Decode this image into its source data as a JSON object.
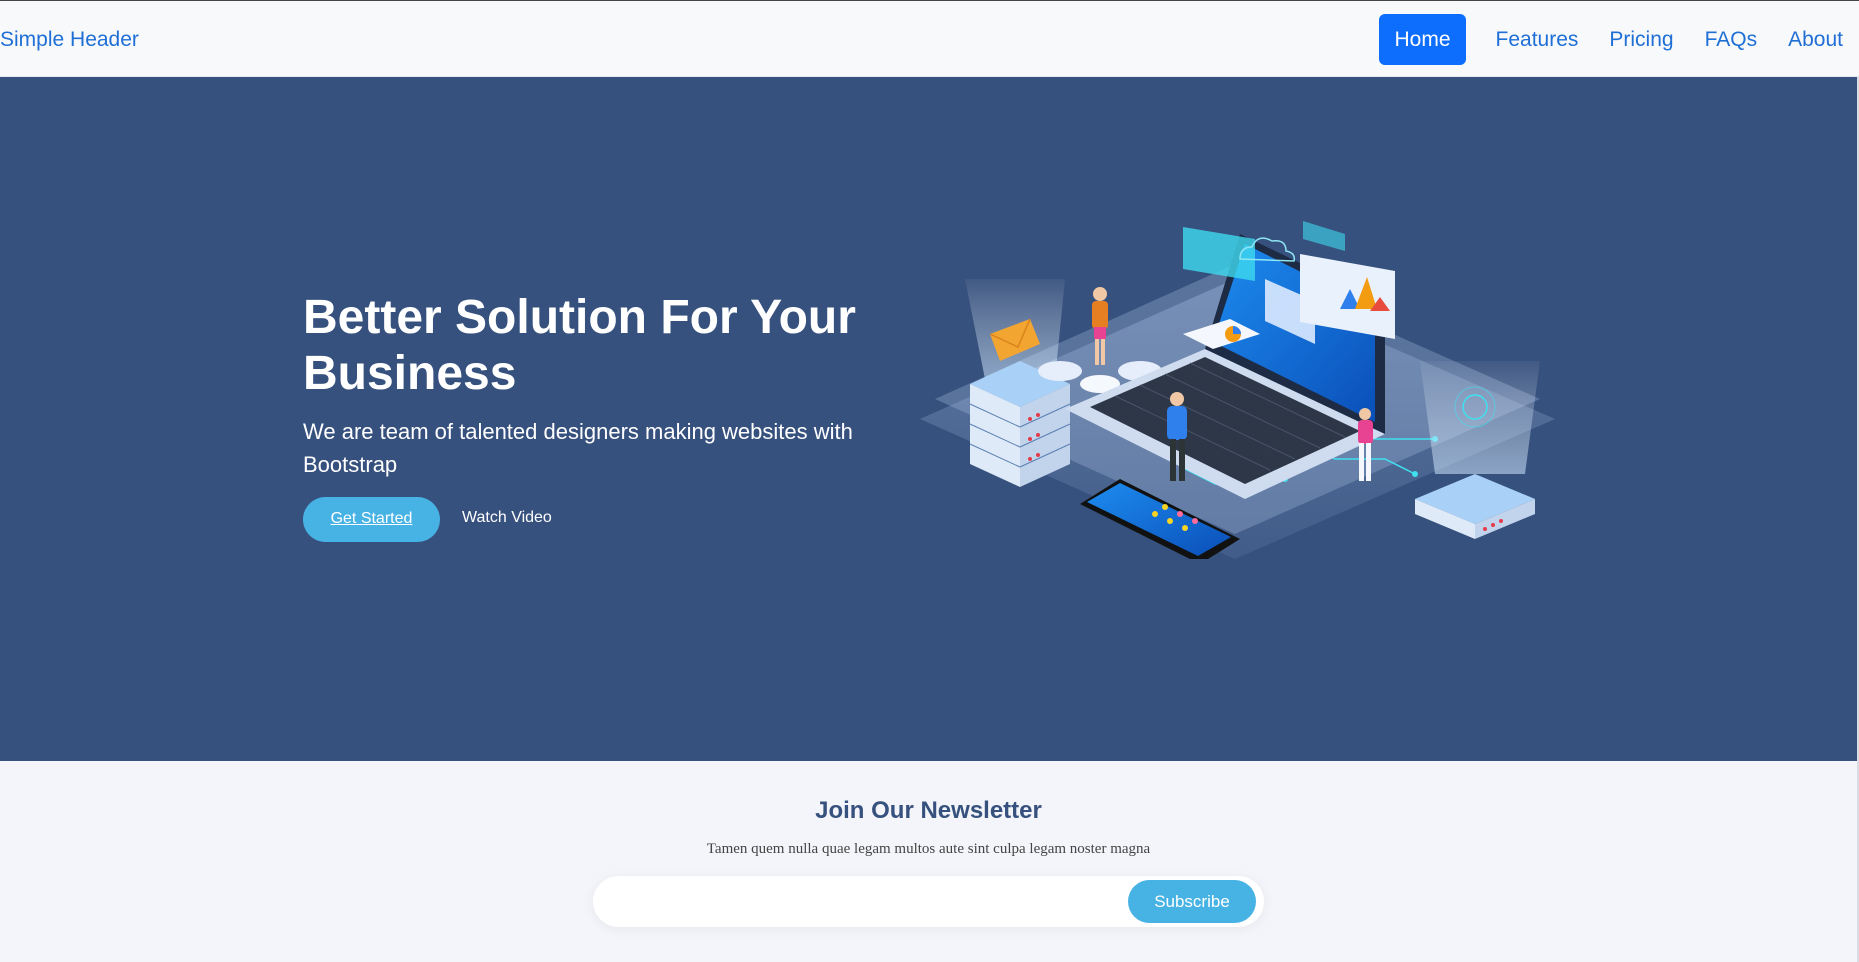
{
  "header": {
    "brand": "Simple Header",
    "nav": [
      {
        "label": "Home",
        "active": true
      },
      {
        "label": "Features"
      },
      {
        "label": "Pricing"
      },
      {
        "label": "FAQs"
      },
      {
        "label": "About"
      }
    ]
  },
  "hero": {
    "title": "Better Solution For Your Business",
    "subtitle": "We are team of talented designers making websites with Bootstrap",
    "primary_button": "Get Started",
    "secondary_link": "Watch Video",
    "illustration": "isometric-technology-illustration"
  },
  "newsletter": {
    "title": "Join Our Newsletter",
    "text": "Tamen quem nulla quae legam multos aute sint culpa legam noster magna",
    "email_value": "",
    "button": "Subscribe"
  },
  "colors": {
    "hero_bg": "#37517e",
    "accent": "#47b2e4",
    "nav_link": "#1f6fd6",
    "nav_active": "#0d6efd"
  }
}
